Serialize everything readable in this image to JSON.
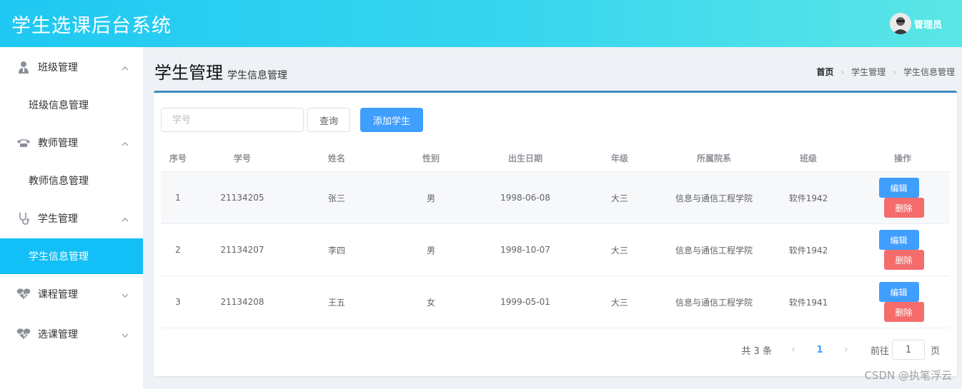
{
  "header": {
    "title": "学生选课后台系统",
    "user_name": "管理员"
  },
  "sidebar": {
    "groups": [
      {
        "label": "班级管理",
        "icon": "user-tie-icon",
        "sub": "班级信息管理"
      },
      {
        "label": "教师管理",
        "icon": "telephone-icon",
        "sub": "教师信息管理"
      },
      {
        "label": "学生管理",
        "icon": "stethoscope-icon",
        "sub": "学生信息管理"
      },
      {
        "label": "课程管理",
        "icon": "heartbeat-icon"
      },
      {
        "label": "选课管理",
        "icon": "heartbeat-icon"
      }
    ]
  },
  "page": {
    "title": "学生管理",
    "subtitle": "学生信息管理"
  },
  "breadcrumb": [
    "首页",
    "学生管理",
    "学生信息管理"
  ],
  "toolbar": {
    "search_placeholder": "学号",
    "query_label": "查询",
    "add_label": "添加学生"
  },
  "table": {
    "headers": [
      "序号",
      "学号",
      "姓名",
      "性别",
      "出生日期",
      "年级",
      "所属院系",
      "班级",
      "操作"
    ],
    "rows": [
      [
        "1",
        "21134205",
        "张三",
        "男",
        "1998-06-08",
        "大三",
        "信息与通信工程学院",
        "软件1942"
      ],
      [
        "2",
        "21134207",
        "李四",
        "男",
        "1998-10-07",
        "大三",
        "信息与通信工程学院",
        "软件1942"
      ],
      [
        "3",
        "21134208",
        "王五",
        "女",
        "1999-05-01",
        "大三",
        "信息与通信工程学院",
        "软件1941"
      ]
    ],
    "edit_label": "编辑",
    "delete_label": "删除"
  },
  "pagination": {
    "total_text": "共 3 条",
    "current_page": "1",
    "goto_label": "前往",
    "goto_value": "1",
    "page_suffix": "页"
  },
  "watermark": "CSDN @执笔浮云"
}
